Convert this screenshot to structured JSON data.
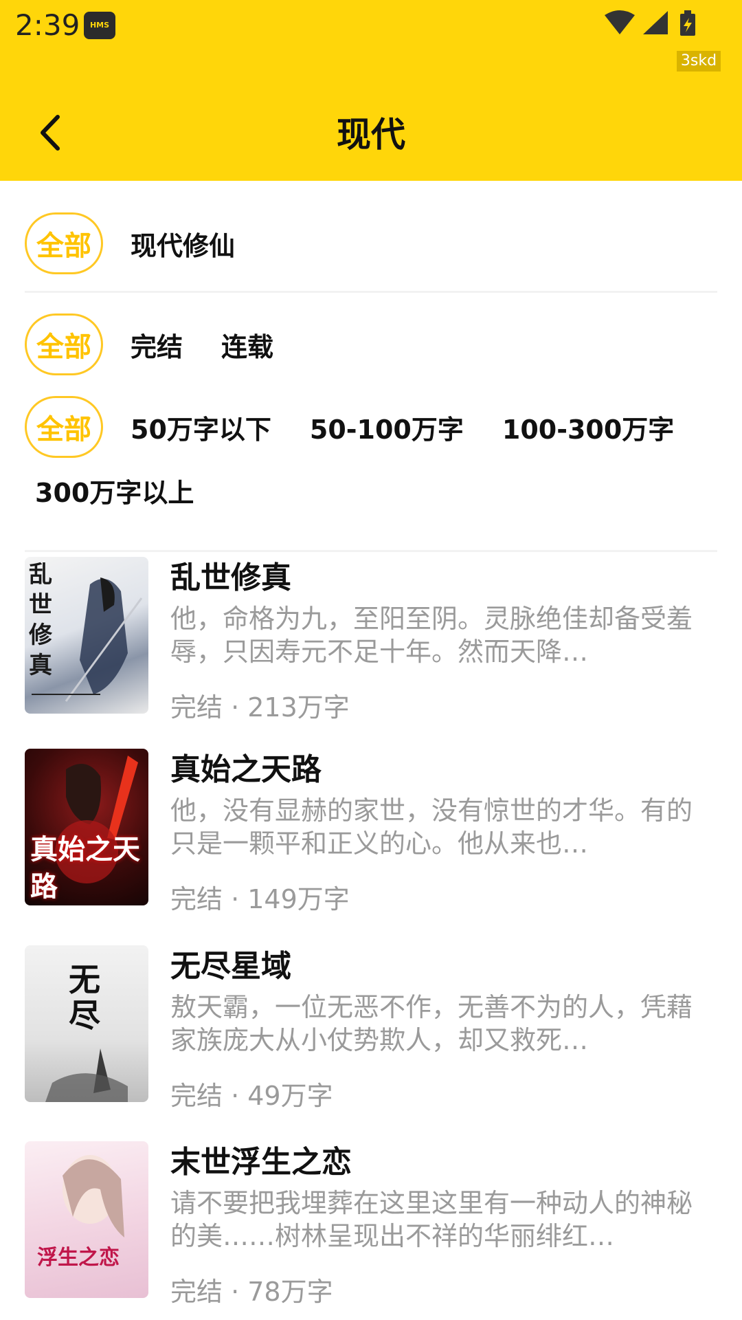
{
  "status_bar": {
    "time": "2:39",
    "hms": "HMS",
    "debug_tag": "3skd"
  },
  "header": {
    "title": "现代",
    "back_icon": "chevron-left-icon"
  },
  "filters": {
    "all_label": "全部",
    "category": [
      "现代修仙"
    ],
    "status": [
      "完结",
      "连载"
    ],
    "word_count": [
      "50万字以下",
      "50-100万字",
      "100-300万字",
      "300万字以上"
    ]
  },
  "colors": {
    "header_bg": "#FFD60A",
    "accent": "#FFC300",
    "muted": "#9A9A9A"
  },
  "books": [
    {
      "title": "乱世修真",
      "desc": "他，命格为九，至阳至阴。灵脉绝佳却备受羞辱，只因寿元不足十年。然而天降…",
      "meta": "完结 · 213万字",
      "cover_text": "乱世修真"
    },
    {
      "title": "真始之天路",
      "desc": "他，没有显赫的家世，没有惊世的才华。有的只是一颗平和正义的心。他从来也…",
      "meta": "完结 · 149万字",
      "cover_text": "真始之天路"
    },
    {
      "title": "无尽星域",
      "desc": "敖天霸，一位无恶不作，无善不为的人，凭藉家族庞大从小仗势欺人，却又救死…",
      "meta": "完结 · 49万字",
      "cover_text": "无尽"
    },
    {
      "title": "末世浮生之恋",
      "desc": "请不要把我埋葬在这里这里有一种动人的神秘的美……树林呈现出不祥的华丽绯红…",
      "meta": "完结 · 78万字",
      "cover_text": "浮生之恋"
    }
  ]
}
